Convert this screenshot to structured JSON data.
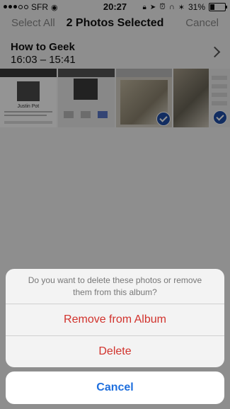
{
  "status_bar": {
    "carrier": "SFR",
    "time": "20:27",
    "battery": "31%"
  },
  "nav": {
    "left": "Select All",
    "title": "2 Photos Selected",
    "right": "Cancel"
  },
  "album": {
    "name": "How to Geek",
    "time_range": "16:03 – 15:41"
  },
  "thumbnails": [
    {
      "caption": "Justin Pot"
    }
  ],
  "action_sheet": {
    "message": "Do you want to delete these photos or remove them from this album?",
    "remove": "Remove from Album",
    "delete": "Delete",
    "cancel": "Cancel"
  },
  "colors": {
    "destructive": "#d1322c",
    "accent": "#1e6fde",
    "check": "#1f4fa8"
  }
}
